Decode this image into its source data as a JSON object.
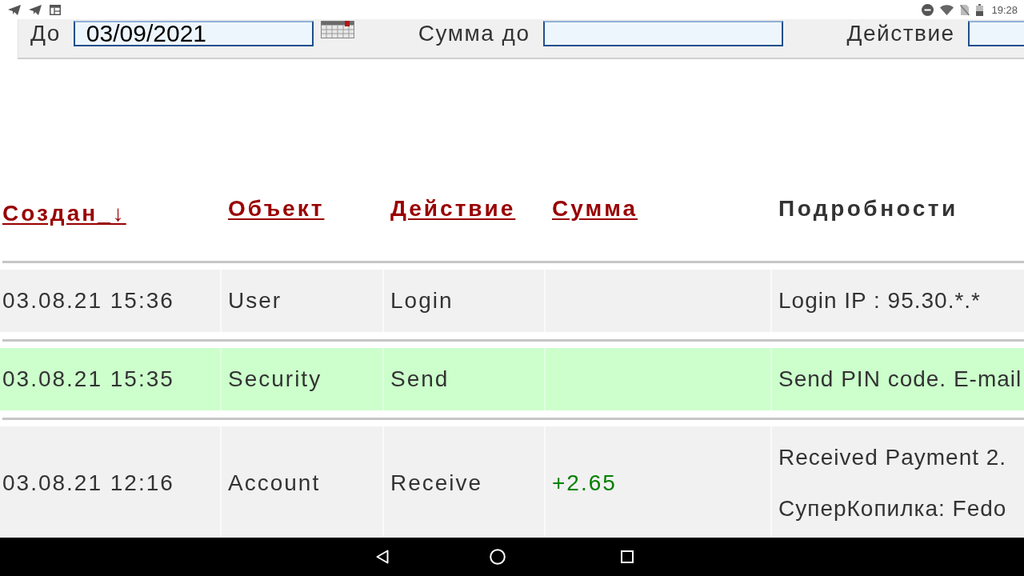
{
  "status_bar": {
    "time": "19:28"
  },
  "filters": [
    {
      "label": "До",
      "value": "03/09/2021",
      "kind": "date"
    },
    {
      "label": "Сумма до",
      "kind": "text"
    },
    {
      "label": "Действие",
      "kind": "text"
    }
  ],
  "table": {
    "columns": [
      {
        "label": "Создан_↓",
        "sortable": true
      },
      {
        "label": "Объект",
        "sortable": true
      },
      {
        "label": "Действие",
        "sortable": true
      },
      {
        "label": "Сумма",
        "sortable": true
      },
      {
        "label": "Подробности",
        "sortable": false
      }
    ],
    "rows": [
      {
        "created": "03.08.21 15:36",
        "object": "User",
        "action": "Login",
        "details": [
          "Login IP : 95.30.*.*"
        ],
        "highlighted": false
      },
      {
        "created": "03.08.21 15:35",
        "object": "Security",
        "action": "Send",
        "details": [
          "Send PIN code. E-mail"
        ],
        "highlighted": true
      },
      {
        "created": "03.08.21 12:16",
        "object": "Account",
        "action": "Receive",
        "amount": "+2.65",
        "details": [
          "Received Payment 2.",
          "СуперКопилка: Fedo"
        ],
        "highlighted": false
      }
    ]
  }
}
